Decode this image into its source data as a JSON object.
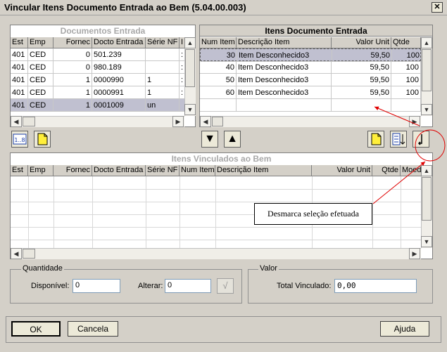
{
  "window": {
    "title": "Vincular Itens Documento Entrada ao Bem (5.04.00.003)",
    "close_glyph": "✕"
  },
  "docs_panel": {
    "title": "Documentos Entrada",
    "columns": [
      "Est",
      "Emp",
      "Fornec",
      "Docto Entrada",
      "Série NF",
      "I"
    ],
    "rows": [
      [
        "401",
        "CED",
        "0",
        "501.239",
        "",
        ":"
      ],
      [
        "401",
        "CED",
        "0",
        "980.189",
        "",
        ":"
      ],
      [
        "401",
        "CED",
        "1",
        "0000990",
        "1",
        ":"
      ],
      [
        "401",
        "CED",
        "1",
        "0000991",
        "1",
        ":"
      ],
      [
        "401",
        "CED",
        "1",
        "0001009",
        "un",
        ""
      ]
    ]
  },
  "items_panel": {
    "title": "Itens Documento Entrada",
    "columns": [
      "Num Item",
      "Descrição Item",
      "Valor Unit",
      "Qtde"
    ],
    "rows": [
      [
        "30",
        "Item Desconhecido3",
        "59,50",
        "100"
      ],
      [
        "40",
        "Item Desconhecido3",
        "59,50",
        "100"
      ],
      [
        "50",
        "Item Desconhecido3",
        "59,50",
        "100"
      ],
      [
        "60",
        "Item Desconhecido3",
        "59,50",
        "100"
      ]
    ]
  },
  "middle_toolbar": {
    "move_down_glyph": "▼",
    "move_up_glyph": "▲"
  },
  "linked_panel": {
    "title": "Itens Vinculados ao Bem",
    "columns": [
      "Est",
      "Emp",
      "Fornec",
      "Docto Entrada",
      "Série NF",
      "Num Item",
      "Descrição Item",
      "Valor Unit",
      "Qtde",
      "Moed"
    ]
  },
  "callout": {
    "text": "Desmarca seleção efetuada"
  },
  "quantidade": {
    "legend": "Quantidade",
    "disponivel_label": "Disponível:",
    "disponivel_value": "0",
    "alterar_label": "Alterar:",
    "alterar_value": "0",
    "confirm_glyph": "√"
  },
  "valor": {
    "legend": "Valor",
    "total_label": "Total Vinculado:",
    "total_value": "0,00"
  },
  "buttons": {
    "ok": "OK",
    "cancel": "Cancela",
    "help": "Ajuda"
  },
  "colors": {
    "annotation": "#e00000",
    "selected_row": "#c0c0d0"
  }
}
